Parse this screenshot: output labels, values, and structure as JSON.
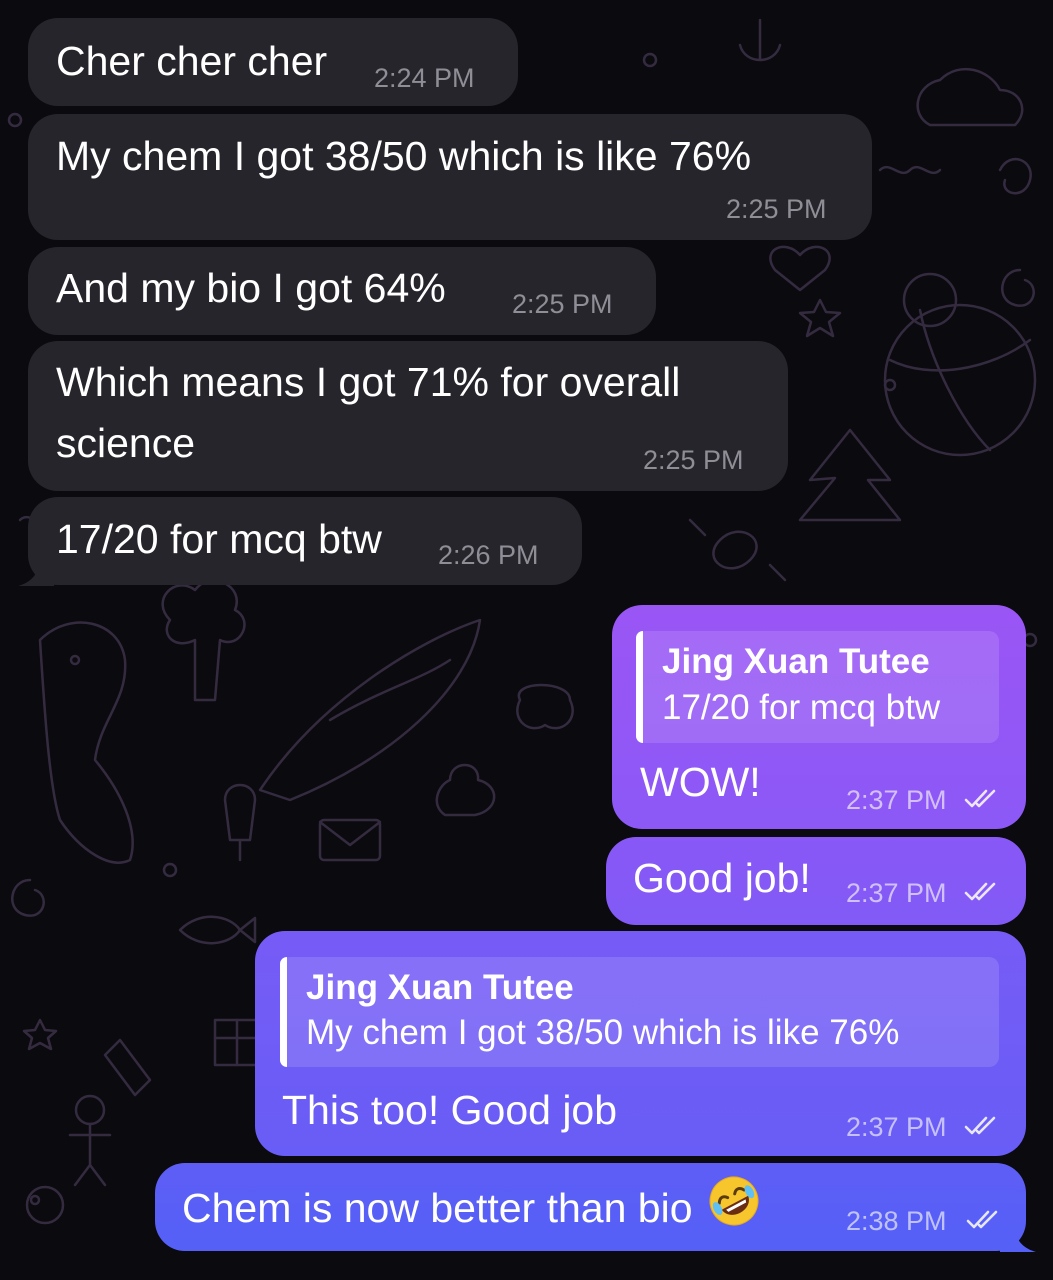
{
  "chat": {
    "colors": {
      "background": "#0b0a0e",
      "incoming_bubble": "#26252c",
      "outgoing_top": "#9b55f5",
      "outgoing_bottom": "#4e5ef5"
    },
    "messages": [
      {
        "direction": "incoming",
        "text": "Cher cher cher",
        "time": "2:24 PM"
      },
      {
        "direction": "incoming",
        "text": "My chem I got 38/50 which is like 76%",
        "time": "2:25 PM"
      },
      {
        "direction": "incoming",
        "text": "And my bio I got 64%",
        "time": "2:25 PM"
      },
      {
        "direction": "incoming",
        "text_line1": "Which means I got 71% for overall",
        "text_line2": "science",
        "time": "2:25 PM"
      },
      {
        "direction": "incoming",
        "text": "17/20 for mcq btw",
        "time": "2:26 PM"
      },
      {
        "direction": "outgoing",
        "reply_name": "Jing Xuan Tutee",
        "reply_text": "17/20 for mcq btw",
        "text": "WOW!",
        "time": "2:37 PM",
        "status_icon": "double-check-icon"
      },
      {
        "direction": "outgoing",
        "text": "Good job!",
        "time": "2:37 PM",
        "status_icon": "double-check-icon"
      },
      {
        "direction": "outgoing",
        "reply_name": "Jing Xuan Tutee",
        "reply_text": "My chem I got 38/50 which is like 76%",
        "text": "This too! Good job",
        "time": "2:37 PM",
        "status_icon": "double-check-icon"
      },
      {
        "direction": "outgoing",
        "text": "Chem is now better than bio",
        "emoji_icon": "rolling-on-floor-laughing-emoji-icon",
        "time": "2:38 PM",
        "status_icon": "double-check-icon"
      }
    ]
  }
}
